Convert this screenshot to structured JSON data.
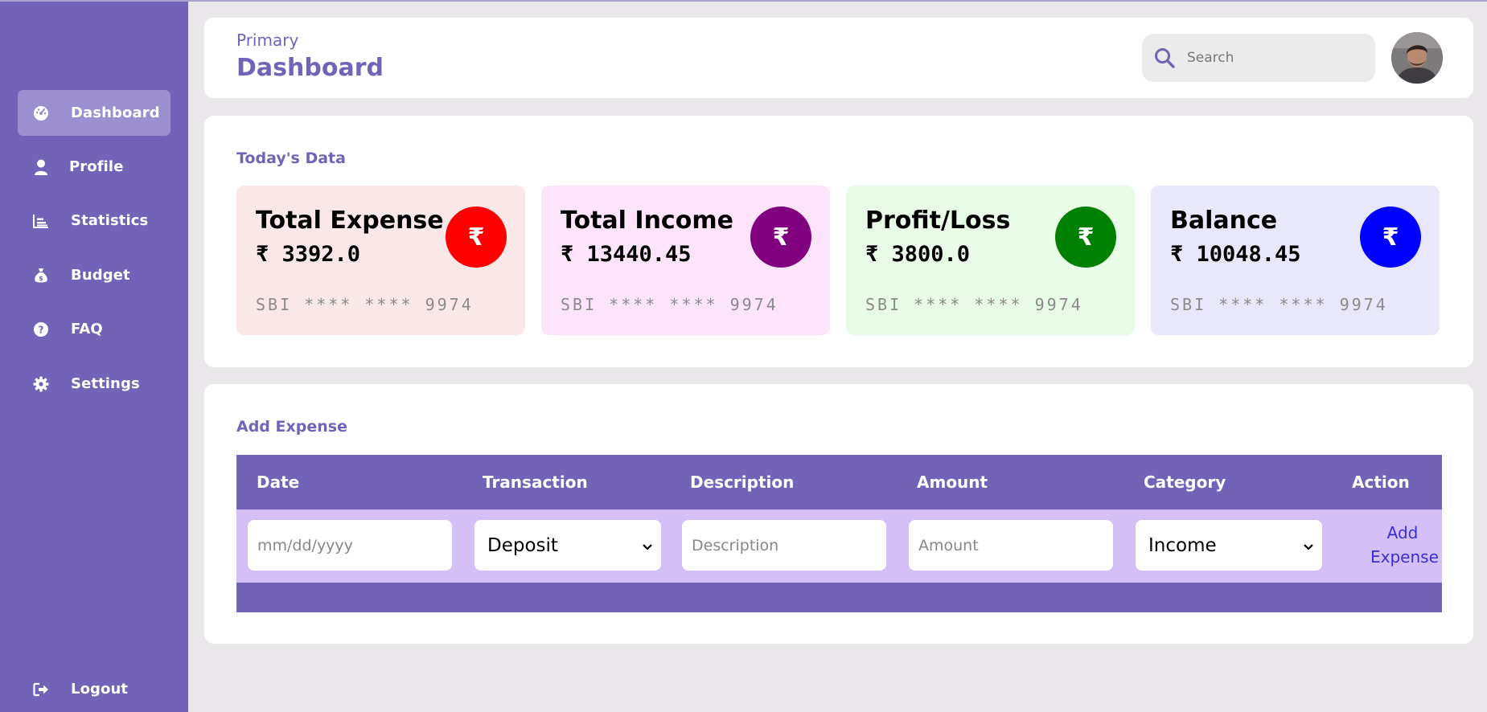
{
  "sidebar": {
    "items": [
      {
        "label": "Dashboard",
        "icon": "gauge-icon",
        "active": true
      },
      {
        "label": "Profile",
        "icon": "user-icon"
      },
      {
        "label": "Statistics",
        "icon": "bar-chart-icon"
      },
      {
        "label": "Budget",
        "icon": "money-bag-icon"
      },
      {
        "label": "FAQ",
        "icon": "question-circle-icon"
      },
      {
        "label": "Settings",
        "icon": "gear-icon"
      }
    ],
    "logout": {
      "label": "Logout",
      "icon": "logout-icon"
    }
  },
  "header": {
    "breadcrumb": "Primary",
    "title": "Dashboard",
    "search_placeholder": "Search"
  },
  "today": {
    "title": "Today's Data",
    "cards": [
      {
        "label": "Total Expense",
        "value": "₹ 3392.0",
        "account": "SBI **** **** 9974",
        "bg": "#f9e8e7",
        "circle": "#ff0000"
      },
      {
        "label": "Total Income",
        "value": "₹ 13440.45",
        "account": "SBI **** **** 9974",
        "bg": "#fde4fb",
        "circle": "#800080"
      },
      {
        "label": "Profit/Loss",
        "value": "₹ 3800.0",
        "account": "SBI **** **** 9974",
        "bg": "#e8fbe6",
        "circle": "#008000"
      },
      {
        "label": "Balance",
        "value": "₹ 10048.45",
        "account": "SBI **** **** 9974",
        "bg": "#e9e7fb",
        "circle": "#0000ff"
      }
    ],
    "currency_symbol": "₹"
  },
  "add_expense": {
    "title": "Add Expense",
    "columns": [
      "Date",
      "Transaction",
      "Description",
      "Amount",
      "Category",
      "Action"
    ],
    "date_placeholder": "mm/dd/yyyy",
    "transaction_selected": "Deposit",
    "description_placeholder": "Description",
    "amount_placeholder": "Amount",
    "category_selected": "Income",
    "action_label_1": "Add",
    "action_label_2": "Expense"
  },
  "colors": {
    "accent": "#7263b8",
    "row_bg": "#d4bff6",
    "action_link": "#3a2fd6"
  }
}
